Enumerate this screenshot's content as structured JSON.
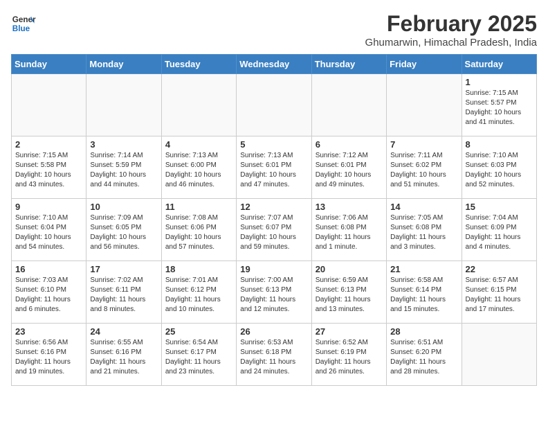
{
  "header": {
    "logo_line1": "General",
    "logo_line2": "Blue",
    "month": "February 2025",
    "location": "Ghumarwin, Himachal Pradesh, India"
  },
  "days_of_week": [
    "Sunday",
    "Monday",
    "Tuesday",
    "Wednesday",
    "Thursday",
    "Friday",
    "Saturday"
  ],
  "weeks": [
    [
      {
        "day": "",
        "info": ""
      },
      {
        "day": "",
        "info": ""
      },
      {
        "day": "",
        "info": ""
      },
      {
        "day": "",
        "info": ""
      },
      {
        "day": "",
        "info": ""
      },
      {
        "day": "",
        "info": ""
      },
      {
        "day": "1",
        "info": "Sunrise: 7:15 AM\nSunset: 5:57 PM\nDaylight: 10 hours and 41 minutes."
      }
    ],
    [
      {
        "day": "2",
        "info": "Sunrise: 7:15 AM\nSunset: 5:58 PM\nDaylight: 10 hours and 43 minutes."
      },
      {
        "day": "3",
        "info": "Sunrise: 7:14 AM\nSunset: 5:59 PM\nDaylight: 10 hours and 44 minutes."
      },
      {
        "day": "4",
        "info": "Sunrise: 7:13 AM\nSunset: 6:00 PM\nDaylight: 10 hours and 46 minutes."
      },
      {
        "day": "5",
        "info": "Sunrise: 7:13 AM\nSunset: 6:01 PM\nDaylight: 10 hours and 47 minutes."
      },
      {
        "day": "6",
        "info": "Sunrise: 7:12 AM\nSunset: 6:01 PM\nDaylight: 10 hours and 49 minutes."
      },
      {
        "day": "7",
        "info": "Sunrise: 7:11 AM\nSunset: 6:02 PM\nDaylight: 10 hours and 51 minutes."
      },
      {
        "day": "8",
        "info": "Sunrise: 7:10 AM\nSunset: 6:03 PM\nDaylight: 10 hours and 52 minutes."
      }
    ],
    [
      {
        "day": "9",
        "info": "Sunrise: 7:10 AM\nSunset: 6:04 PM\nDaylight: 10 hours and 54 minutes."
      },
      {
        "day": "10",
        "info": "Sunrise: 7:09 AM\nSunset: 6:05 PM\nDaylight: 10 hours and 56 minutes."
      },
      {
        "day": "11",
        "info": "Sunrise: 7:08 AM\nSunset: 6:06 PM\nDaylight: 10 hours and 57 minutes."
      },
      {
        "day": "12",
        "info": "Sunrise: 7:07 AM\nSunset: 6:07 PM\nDaylight: 10 hours and 59 minutes."
      },
      {
        "day": "13",
        "info": "Sunrise: 7:06 AM\nSunset: 6:08 PM\nDaylight: 11 hours and 1 minute."
      },
      {
        "day": "14",
        "info": "Sunrise: 7:05 AM\nSunset: 6:08 PM\nDaylight: 11 hours and 3 minutes."
      },
      {
        "day": "15",
        "info": "Sunrise: 7:04 AM\nSunset: 6:09 PM\nDaylight: 11 hours and 4 minutes."
      }
    ],
    [
      {
        "day": "16",
        "info": "Sunrise: 7:03 AM\nSunset: 6:10 PM\nDaylight: 11 hours and 6 minutes."
      },
      {
        "day": "17",
        "info": "Sunrise: 7:02 AM\nSunset: 6:11 PM\nDaylight: 11 hours and 8 minutes."
      },
      {
        "day": "18",
        "info": "Sunrise: 7:01 AM\nSunset: 6:12 PM\nDaylight: 11 hours and 10 minutes."
      },
      {
        "day": "19",
        "info": "Sunrise: 7:00 AM\nSunset: 6:13 PM\nDaylight: 11 hours and 12 minutes."
      },
      {
        "day": "20",
        "info": "Sunrise: 6:59 AM\nSunset: 6:13 PM\nDaylight: 11 hours and 13 minutes."
      },
      {
        "day": "21",
        "info": "Sunrise: 6:58 AM\nSunset: 6:14 PM\nDaylight: 11 hours and 15 minutes."
      },
      {
        "day": "22",
        "info": "Sunrise: 6:57 AM\nSunset: 6:15 PM\nDaylight: 11 hours and 17 minutes."
      }
    ],
    [
      {
        "day": "23",
        "info": "Sunrise: 6:56 AM\nSunset: 6:16 PM\nDaylight: 11 hours and 19 minutes."
      },
      {
        "day": "24",
        "info": "Sunrise: 6:55 AM\nSunset: 6:16 PM\nDaylight: 11 hours and 21 minutes."
      },
      {
        "day": "25",
        "info": "Sunrise: 6:54 AM\nSunset: 6:17 PM\nDaylight: 11 hours and 23 minutes."
      },
      {
        "day": "26",
        "info": "Sunrise: 6:53 AM\nSunset: 6:18 PM\nDaylight: 11 hours and 24 minutes."
      },
      {
        "day": "27",
        "info": "Sunrise: 6:52 AM\nSunset: 6:19 PM\nDaylight: 11 hours and 26 minutes."
      },
      {
        "day": "28",
        "info": "Sunrise: 6:51 AM\nSunset: 6:20 PM\nDaylight: 11 hours and 28 minutes."
      },
      {
        "day": "",
        "info": ""
      }
    ]
  ]
}
